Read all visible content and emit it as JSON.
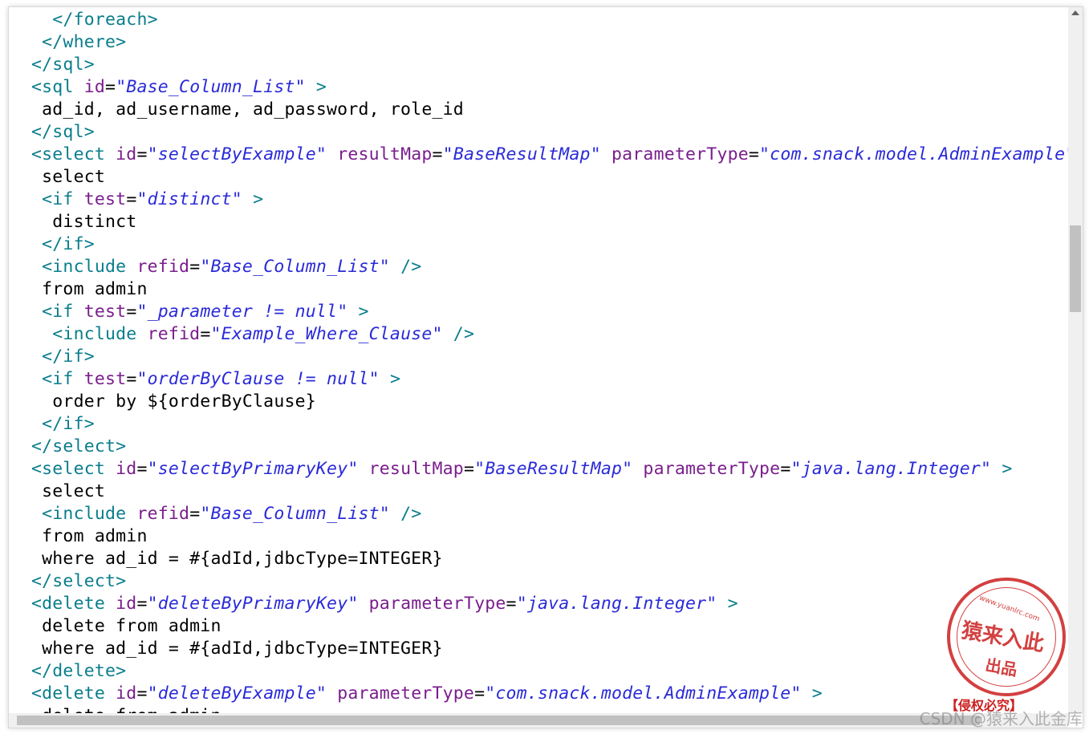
{
  "code_lines": [
    [
      {
        "t": "tag",
        "v": "  </foreach>"
      }
    ],
    [
      {
        "t": "tag",
        "v": " </where>"
      }
    ],
    [
      {
        "t": "tag",
        "v": "</sql>"
      }
    ],
    [
      {
        "t": "tag",
        "v": "<sql "
      },
      {
        "t": "attr",
        "v": "id"
      },
      {
        "t": "txt",
        "v": "="
      },
      {
        "t": "val",
        "v": "\"Base_Column_List\""
      },
      {
        "t": "tag",
        "v": " >"
      }
    ],
    [
      {
        "t": "txt",
        "v": " ad_id, ad_username, ad_password, role_id"
      }
    ],
    [
      {
        "t": "tag",
        "v": "</sql>"
      }
    ],
    [
      {
        "t": "tag",
        "v": "<select "
      },
      {
        "t": "attr",
        "v": "id"
      },
      {
        "t": "txt",
        "v": "="
      },
      {
        "t": "val",
        "v": "\"selectByExample\""
      },
      {
        "t": "attr",
        "v": " resultMap"
      },
      {
        "t": "txt",
        "v": "="
      },
      {
        "t": "val",
        "v": "\"BaseResultMap\""
      },
      {
        "t": "attr",
        "v": " parameterType"
      },
      {
        "t": "txt",
        "v": "="
      },
      {
        "t": "val",
        "v": "\"com.snack.model.AdminExample\""
      }
    ],
    [
      {
        "t": "txt",
        "v": " select"
      }
    ],
    [
      {
        "t": "tag",
        "v": " <if "
      },
      {
        "t": "attr",
        "v": "test"
      },
      {
        "t": "txt",
        "v": "="
      },
      {
        "t": "val",
        "v": "\"distinct\""
      },
      {
        "t": "tag",
        "v": " >"
      }
    ],
    [
      {
        "t": "txt",
        "v": "  distinct"
      }
    ],
    [
      {
        "t": "tag",
        "v": " </if>"
      }
    ],
    [
      {
        "t": "tag",
        "v": " <include "
      },
      {
        "t": "attr",
        "v": "refid"
      },
      {
        "t": "txt",
        "v": "="
      },
      {
        "t": "val",
        "v": "\"Base_Column_List\""
      },
      {
        "t": "tag",
        "v": " />"
      }
    ],
    [
      {
        "t": "txt",
        "v": " from admin"
      }
    ],
    [
      {
        "t": "tag",
        "v": " <if "
      },
      {
        "t": "attr",
        "v": "test"
      },
      {
        "t": "txt",
        "v": "="
      },
      {
        "t": "val",
        "v": "\"_parameter != null\""
      },
      {
        "t": "tag",
        "v": " >"
      }
    ],
    [
      {
        "t": "tag",
        "v": "  <include "
      },
      {
        "t": "attr",
        "v": "refid"
      },
      {
        "t": "txt",
        "v": "="
      },
      {
        "t": "val",
        "v": "\"Example_Where_Clause\""
      },
      {
        "t": "tag",
        "v": " />"
      }
    ],
    [
      {
        "t": "tag",
        "v": " </if>"
      }
    ],
    [
      {
        "t": "tag",
        "v": " <if "
      },
      {
        "t": "attr",
        "v": "test"
      },
      {
        "t": "txt",
        "v": "="
      },
      {
        "t": "val",
        "v": "\"orderByClause != null\""
      },
      {
        "t": "tag",
        "v": " >"
      }
    ],
    [
      {
        "t": "txt",
        "v": "  order by ${orderByClause}"
      }
    ],
    [
      {
        "t": "tag",
        "v": " </if>"
      }
    ],
    [
      {
        "t": "tag",
        "v": "</select>"
      }
    ],
    [
      {
        "t": "tag",
        "v": "<select "
      },
      {
        "t": "attr",
        "v": "id"
      },
      {
        "t": "txt",
        "v": "="
      },
      {
        "t": "val",
        "v": "\"selectByPrimaryKey\""
      },
      {
        "t": "attr",
        "v": " resultMap"
      },
      {
        "t": "txt",
        "v": "="
      },
      {
        "t": "val",
        "v": "\"BaseResultMap\""
      },
      {
        "t": "attr",
        "v": " parameterType"
      },
      {
        "t": "txt",
        "v": "="
      },
      {
        "t": "val",
        "v": "\"java.lang.Integer\""
      },
      {
        "t": "tag",
        "v": " >"
      }
    ],
    [
      {
        "t": "txt",
        "v": " select"
      }
    ],
    [
      {
        "t": "tag",
        "v": " <include "
      },
      {
        "t": "attr",
        "v": "refid"
      },
      {
        "t": "txt",
        "v": "="
      },
      {
        "t": "val",
        "v": "\"Base_Column_List\""
      },
      {
        "t": "tag",
        "v": " />"
      }
    ],
    [
      {
        "t": "txt",
        "v": " from admin"
      }
    ],
    [
      {
        "t": "txt",
        "v": " where ad_id = #{adId,jdbcType=INTEGER}"
      }
    ],
    [
      {
        "t": "tag",
        "v": "</select>"
      }
    ],
    [
      {
        "t": "tag",
        "v": "<delete "
      },
      {
        "t": "attr",
        "v": "id"
      },
      {
        "t": "txt",
        "v": "="
      },
      {
        "t": "val",
        "v": "\"deleteByPrimaryKey\""
      },
      {
        "t": "attr",
        "v": " parameterType"
      },
      {
        "t": "txt",
        "v": "="
      },
      {
        "t": "val",
        "v": "\"java.lang.Integer\""
      },
      {
        "t": "tag",
        "v": " >"
      }
    ],
    [
      {
        "t": "txt",
        "v": " delete from admin"
      }
    ],
    [
      {
        "t": "txt",
        "v": " where ad_id = #{adId,jdbcType=INTEGER}"
      }
    ],
    [
      {
        "t": "tag",
        "v": "</delete>"
      }
    ],
    [
      {
        "t": "tag",
        "v": "<delete "
      },
      {
        "t": "attr",
        "v": "id"
      },
      {
        "t": "txt",
        "v": "="
      },
      {
        "t": "val",
        "v": "\"deleteByExample\""
      },
      {
        "t": "attr",
        "v": " parameterType"
      },
      {
        "t": "txt",
        "v": "="
      },
      {
        "t": "val",
        "v": "\"com.snack.model.AdminExample\""
      },
      {
        "t": "tag",
        "v": " >"
      }
    ],
    [
      {
        "t": "txt",
        "v": " delete from admin"
      }
    ]
  ],
  "stamp": {
    "url": "www.yuanlrc.com",
    "title": "猿来入此",
    "subtitle": "出品",
    "caption": "【侵权必究】"
  },
  "watermark": "CSDN @猿来入此金库",
  "colors": {
    "tag": "#0a7d8c",
    "attribute": "#7a1e8c",
    "value": "#2a2ad8",
    "text": "#000000",
    "stamp": "#cc1f1f"
  },
  "icons": {
    "scroll_up": "triangle-up-icon",
    "stamp_logo": "apple-icon"
  }
}
